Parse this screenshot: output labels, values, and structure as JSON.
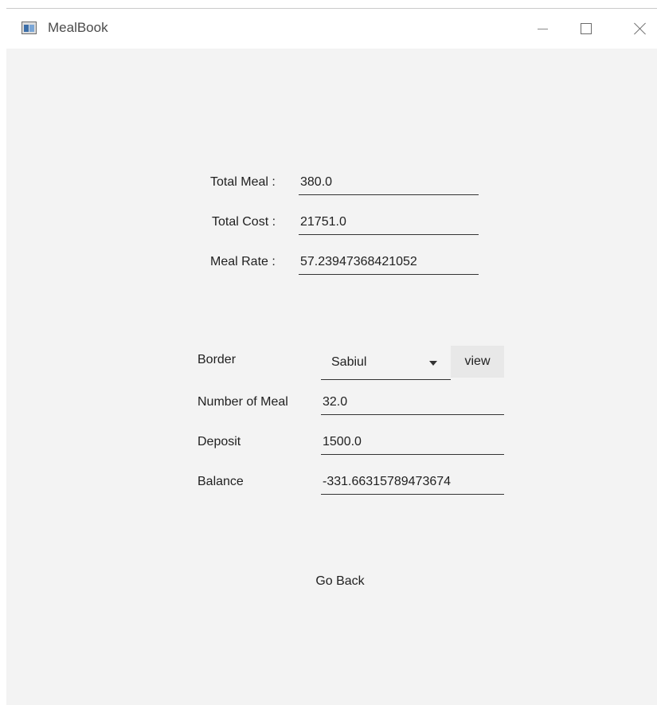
{
  "window": {
    "title": "MealBook",
    "controls": {
      "minimize": "minimize",
      "maximize": "maximize",
      "close": "close"
    }
  },
  "summary": {
    "total_meal": {
      "label": "Total Meal :",
      "value": "380.0"
    },
    "total_cost": {
      "label": "Total Cost :",
      "value": "21751.0"
    },
    "meal_rate": {
      "label": "Meal Rate :",
      "value": "57.23947368421052"
    }
  },
  "border_details": {
    "border": {
      "label": "Border",
      "selected": "Sabiul",
      "view_button": "view"
    },
    "number_of_meal": {
      "label": "Number of Meal",
      "value": "32.0"
    },
    "deposit": {
      "label": "Deposit",
      "value": "1500.0"
    },
    "balance": {
      "label": "Balance",
      "value": "-331.66315789473674"
    }
  },
  "actions": {
    "go_back": "Go Back"
  },
  "icons": {
    "app": "app-window-icon",
    "minimize": "minimize-icon",
    "maximize": "maximize-icon",
    "close": "close-icon",
    "dropdown": "chevron-down-icon"
  },
  "colors": {
    "content_background": "#f3f3f3",
    "titlebar_background": "#ffffff",
    "button_background": "#e8e8e8",
    "underline": "#333333"
  }
}
